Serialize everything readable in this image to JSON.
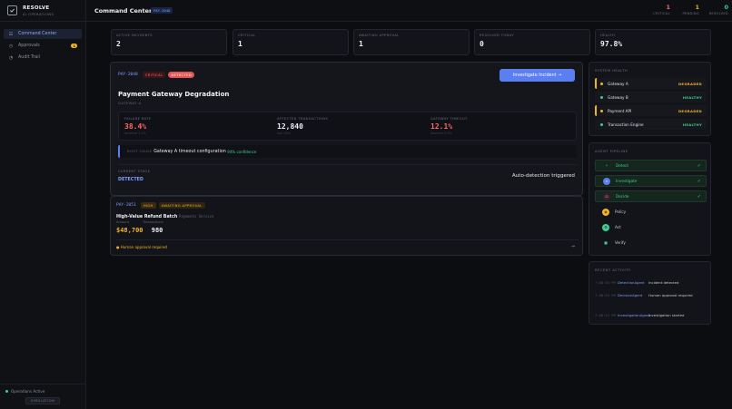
{
  "brand": {
    "name": "RESOLVE",
    "subtitle": "AI OPERATIONS"
  },
  "sidebar": {
    "items": [
      {
        "icon": "☷",
        "label": "Command Center",
        "active": true
      },
      {
        "icon": "◷",
        "label": "Approvals",
        "badge": "1"
      },
      {
        "icon": "◔",
        "label": "Audit Trail"
      }
    ],
    "footer": {
      "status": "Operations Active",
      "mode": "SIMULATION"
    }
  },
  "header": {
    "title": "Command Center",
    "tag": "PAY-2048",
    "counters": [
      {
        "value": "1",
        "label": "CRITICAL",
        "color": "#ff6b6b"
      },
      {
        "value": "1",
        "label": "PENDING",
        "color": "#f0b429"
      },
      {
        "value": "0",
        "label": "RESOLVED",
        "color": "#3ecf8e"
      }
    ]
  },
  "stats": [
    {
      "label": "ACTIVE INCIDENTS",
      "value": "2"
    },
    {
      "label": "CRITICAL",
      "value": "1"
    },
    {
      "label": "AWAITING APPROVAL",
      "value": "1"
    },
    {
      "label": "RESOLVED TODAY",
      "value": "0"
    },
    {
      "label": "HEALTH",
      "value": "97.8%"
    }
  ],
  "incident": {
    "id": "PAY-2048",
    "severity": "CRITICAL",
    "state": "DETECTED",
    "action": "Investigate Incident →",
    "title": "Payment Gateway Degradation",
    "subtitle": "GATEWAY A",
    "metrics": [
      {
        "label": "FAILURE RATE",
        "value": "38.4%",
        "sub": "baseline 2.1%",
        "color": "#ff6b6b"
      },
      {
        "label": "AFFECTED TRANSACTIONS",
        "value": "12,840",
        "sub": "last 15m",
        "color": "#eef0f5"
      },
      {
        "label": "GATEWAY TIMEOUT",
        "value": "12.1%",
        "sub": "baseline 0.3%",
        "color": "#ff6b6b"
      }
    ],
    "root_cause_label": "ROOT CAUSE",
    "root_cause": "Gateway A timeout configuration",
    "confidence": "94% confidence",
    "stage_label": "CURRENT STAGE",
    "stage": "DETECTED",
    "stage_note": "Auto-detection triggered"
  },
  "incident2": {
    "id": "PAY-2051",
    "severity": "HIGH",
    "state": "AWAITING APPROVAL",
    "title": "High-Value Refund Batch",
    "service": "Payments Service",
    "amount_label": "Amount",
    "tx_label": "Transactions",
    "amount": "$48,700",
    "transactions": "980",
    "warning": "● Human approval required",
    "arrow": "→"
  },
  "system_health": {
    "title": "SYSTEM HEALTH",
    "items": [
      {
        "name": "Gateway A",
        "status": "DEGRADED",
        "color": "#f0b429"
      },
      {
        "name": "Gateway B",
        "status": "HEALTHY",
        "color": "#3ecf8e"
      },
      {
        "name": "Payment API",
        "status": "DEGRADED",
        "color": "#f0b429"
      },
      {
        "name": "Transaction Engine",
        "status": "HEALTHY",
        "color": "#3ecf8e"
      }
    ]
  },
  "pipeline": {
    "title": "AGENT PIPELINE",
    "steps": [
      {
        "name": "Detect",
        "icon": "⚡",
        "icon_bg": "#14261e",
        "done": true,
        "check": "✓"
      },
      {
        "name": "Investigate",
        "icon": "⌕",
        "icon_bg": "#5b7ff0",
        "done": true,
        "check": "✓"
      },
      {
        "name": "Decide",
        "icon": "⚖",
        "icon_bg": "#3a1f2a",
        "done": true,
        "check": "✓"
      },
      {
        "name": "Policy",
        "icon": "◈",
        "icon_bg": "#f0b429",
        "done": false
      },
      {
        "name": "Act",
        "icon": "⚙",
        "icon_bg": "#3ecf8e",
        "done": false
      },
      {
        "name": "Verify",
        "icon": "■",
        "icon_bg": "#131419",
        "done": false
      }
    ]
  },
  "activity": {
    "title": "RECENT ACTIVITY",
    "items": [
      {
        "time": "7:08:34 PM",
        "agent": "DetectionAgent",
        "message": "Incident detected"
      },
      {
        "time": "7:08:34 PM",
        "agent": "DecisionAgent",
        "message": "Human approval required"
      },
      {
        "time": "7:08:34 PM",
        "agent": "InvestigationAgent",
        "message": "Investigation started"
      }
    ]
  }
}
